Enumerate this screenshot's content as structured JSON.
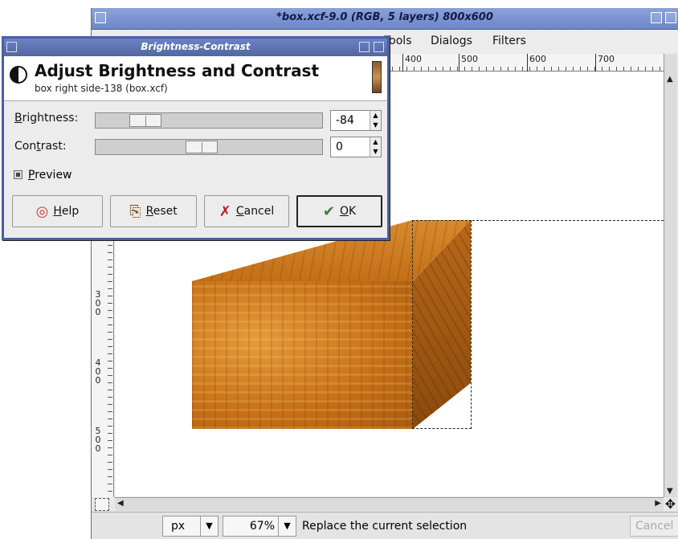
{
  "main_window": {
    "title": "*box.xcf-9.0 (RGB, 5 layers) 800x600",
    "menu": [
      "Tools",
      "Dialogs",
      "Filters"
    ],
    "ruler_h_ticks": [
      "400",
      "500",
      "600",
      "700"
    ],
    "ruler_v_ticks": [
      "300",
      "400",
      "500"
    ],
    "status": {
      "unit": "px",
      "zoom": "67%",
      "message": "Replace the current selection",
      "cancel_label": "Cancel"
    }
  },
  "dialog": {
    "title": "Brightness-Contrast",
    "header_title": "Adjust Brightness and Contrast",
    "header_subtitle": "box right side-138 (box.xcf)",
    "brightness": {
      "label_pre": "B",
      "label_post": "rightness:",
      "value": "-84",
      "level": -84
    },
    "contrast": {
      "label_pre": "Con",
      "label_u": "t",
      "label_post": "rast:",
      "value": "0",
      "level": 0
    },
    "preview": {
      "label_u": "P",
      "label_post": "review",
      "checked": true
    },
    "buttons": {
      "help": {
        "u": "H",
        "rest": "elp"
      },
      "reset": {
        "u": "R",
        "rest": "eset"
      },
      "cancel": {
        "u": "C",
        "rest": "ancel"
      },
      "ok": {
        "u": "O",
        "rest": "K"
      }
    }
  },
  "icons": {
    "help": "help-lifebuoy-icon",
    "reset": "reset-icon",
    "cancel": "cancel-x-icon",
    "ok": "ok-icon",
    "header": "brightness-contrast-icon"
  },
  "colors": {
    "title_bar": "#6c86c8",
    "dialog_border": "#4b5fa3"
  }
}
